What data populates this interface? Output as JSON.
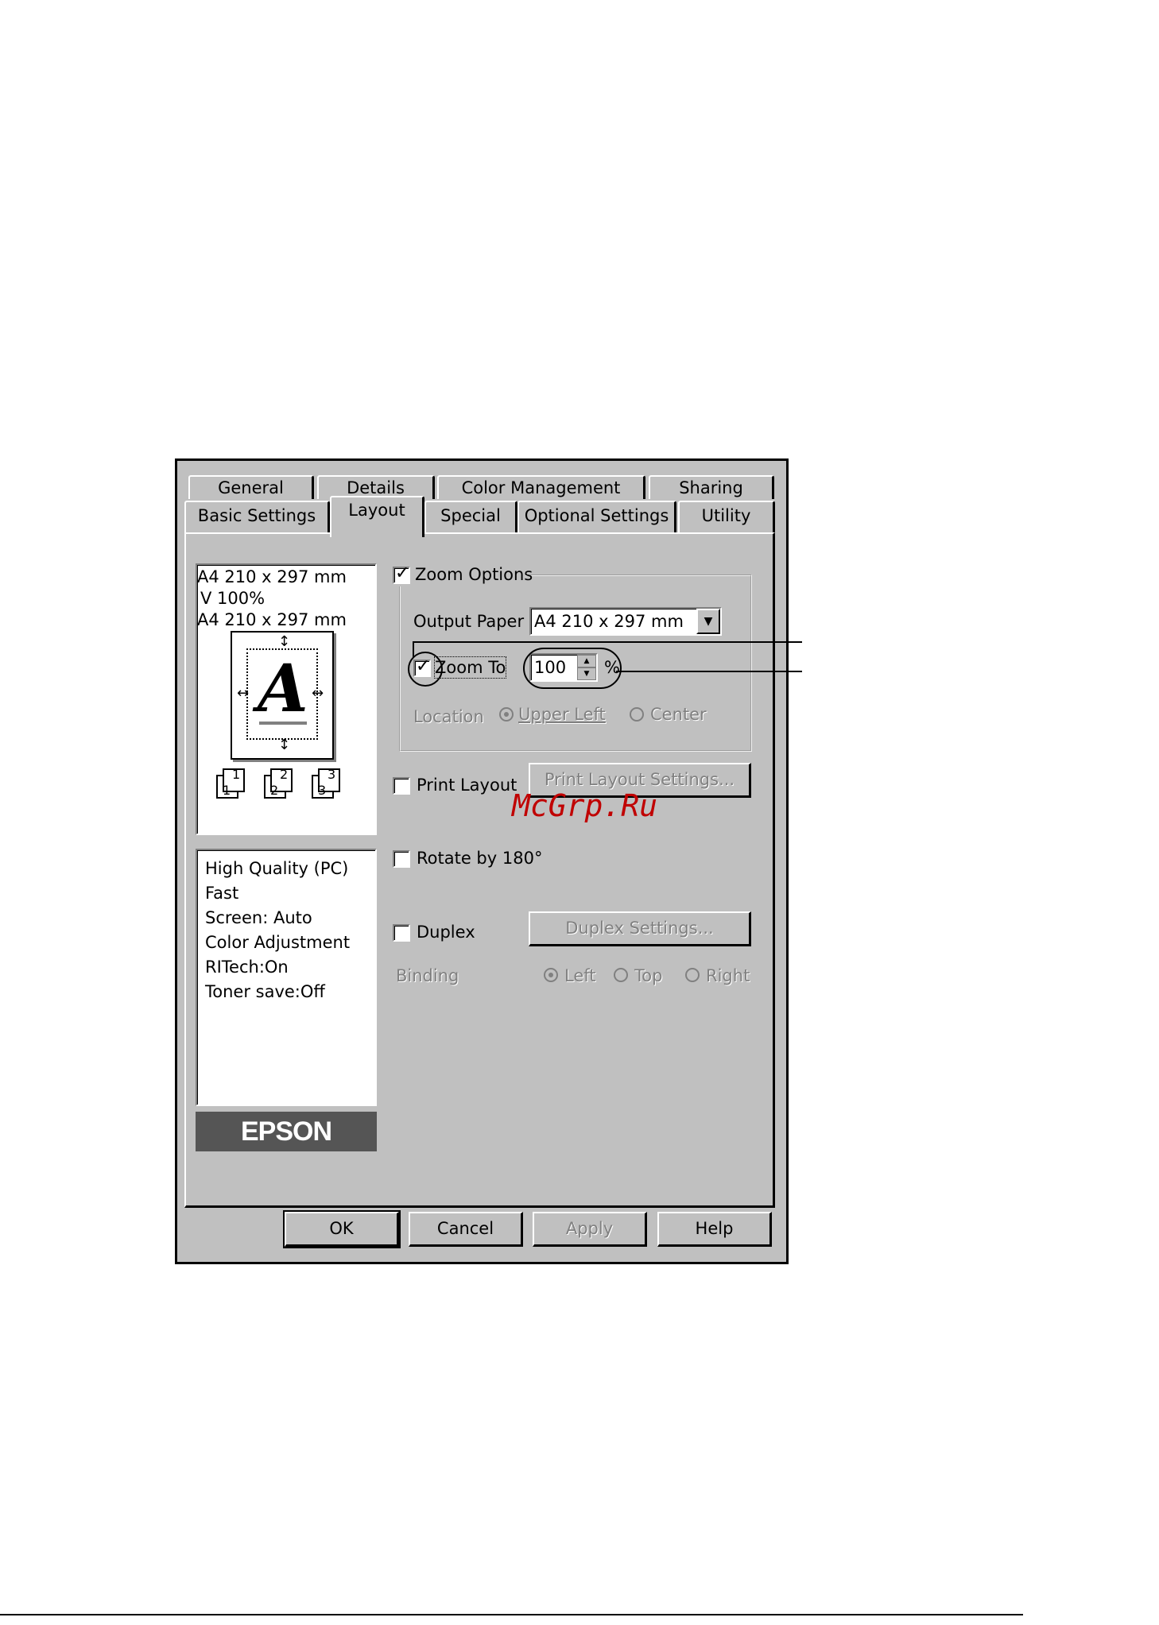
{
  "tabs_row1": [
    "General",
    "Details",
    "Color Management",
    "Sharing"
  ],
  "tabs_row2": [
    "Basic Settings",
    "Layout",
    "Special",
    "Optional Settings",
    "Utility"
  ],
  "preview": {
    "line1": "A4 210 x 297 mm",
    "line2": "V 100%",
    "line3": "A4 210 x 297 mm",
    "glyph": "A",
    "copies": [
      "1",
      "2",
      "3"
    ]
  },
  "status_lines": [
    "High Quality (PC)",
    "Fast",
    "Screen: Auto",
    "Color Adjustment",
    "RITech:On",
    "Toner save:Off"
  ],
  "logo": "EPSON",
  "zoom_options": {
    "label": "Zoom Options",
    "checked": true,
    "output_paper_label": "Output Paper",
    "output_paper_value": "A4 210 x 297 mm",
    "zoom_to_label": "Zoom To",
    "zoom_to_checked": true,
    "zoom_value": "100",
    "percent": "%",
    "location_label": "Location",
    "location_options": [
      "Upper Left",
      "Center"
    ]
  },
  "print_layout": {
    "label": "Print Layout",
    "button": "Print Layout Settings..."
  },
  "rotate": {
    "label": "Rotate by 180°"
  },
  "duplex": {
    "label": "Duplex",
    "button": "Duplex Settings...",
    "binding_label": "Binding",
    "binding_options": [
      "Left",
      "Top",
      "Right"
    ]
  },
  "buttons": {
    "ok": "OK",
    "cancel": "Cancel",
    "apply": "Apply",
    "help": "Help"
  },
  "watermark": "McGrp.Ru"
}
